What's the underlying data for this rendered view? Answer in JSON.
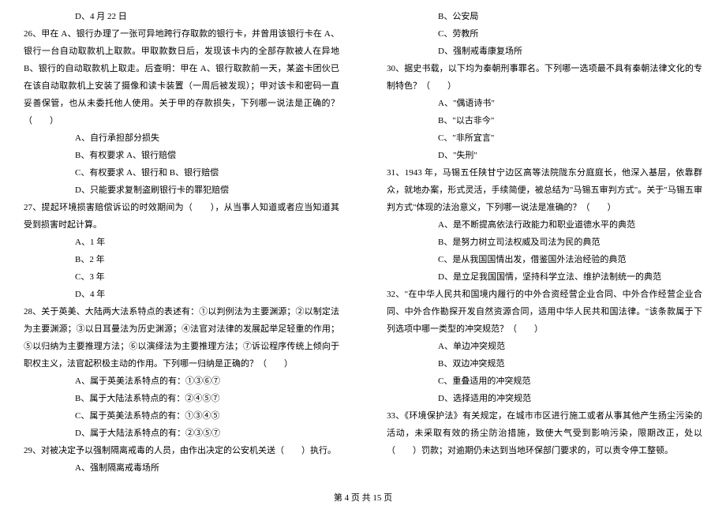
{
  "left_column": {
    "line1": "D、4 月 22 日",
    "q26_text": "26、甲在 A、银行办理了一张可异地跨行存取款的银行卡，并曾用该银行卡在 A、银行一台自动取款机上取款。甲取款数日后，发现该卡内的全部存款被人在异地 B、银行的自动取款机上取走。后查明：甲在 A、银行取款前一天，某盗卡团伙已在该自动取款机上安装了摄像和读卡装置（一周后被发现）；甲对该卡和密码一直妥善保管，也从未委托他人使用。关于甲的存款损失，下列哪一说法是正确的？（　　）",
    "q26_a": "A、自行承担部分损失",
    "q26_b": "B、有权要求 A、银行赔偿",
    "q26_c": "C、有权要求 A、银行和 B、银行赔偿",
    "q26_d": "D、只能要求复制盗刷银行卡的罪犯赔偿",
    "q27_text": "27、提起环境损害赔偿诉讼的时效期间为（　　），从当事人知道或者应当知道其受到损害时起计算。",
    "q27_a": "A、1 年",
    "q27_b": "B、2 年",
    "q27_c": "C、3 年",
    "q27_d": "D、4 年",
    "q28_text": "28、关于英美、大陆两大法系特点的表述有：①以判例法为主要渊源；②以制定法为主要渊源；③以日耳曼法为历史渊源；④法官对法律的发展起举足轻重的作用；⑤以归纳为主要推理方法；⑥以演绎法为主要推理方法；⑦诉讼程序传统上倾向于职权主义，法官起积极主动的作用。下列哪一归纳是正确的？（　　）",
    "q28_a": "A、属于英美法系特点的有：①③⑥⑦",
    "q28_b": "B、属于大陆法系特点的有：②④⑤⑦",
    "q28_c": "C、属于英美法系特点的有：①③④⑤",
    "q28_d": "D、属于大陆法系特点的有：②③⑤⑦",
    "q29_text": "29、对被决定予以强制隔离戒毒的人员，由作出决定的公安机关送（　　）执行。",
    "q29_a": "A、强制隔离戒毒场所"
  },
  "right_column": {
    "q29_b": "B、公安局",
    "q29_c": "C、劳教所",
    "q29_d": "D、强制戒毒康复场所",
    "q30_text": "30、据史书载，以下均为秦朝刑事罪名。下列哪一选项最不具有秦朝法律文化的专制特色？（　　）",
    "q30_a": "A、\"偶语诗书\"",
    "q30_b": "B、\"以古非今\"",
    "q30_c": "C、\"非所宜言\"",
    "q30_d": "D、\"失刑\"",
    "q31_text": "31、1943 年，马锡五任陕甘宁边区高等法院陇东分庭庭长，他深入基层，依靠群众，就地办案，形式灵活，手续简便，被总结为\"马锡五审判方式\"。关于\"马锡五审判方式\"体现的法治意义，下列哪一说法是准确的？（　　）",
    "q31_a": "A、是不断提高依法行政能力和职业道德水平的典范",
    "q31_b": "B、是努力树立司法权威及司法为民的典范",
    "q31_c": "C、是从我国国情出发，借鉴国外法治经验的典范",
    "q31_d": "D、是立足我国国情，坚持科学立法、维护法制统一的典范",
    "q32_text": "32、\"在中华人民共和国境内履行的中外合资经营企业合同、中外合作经营企业合同、中外合作勘探开发自然资源合同，适用中华人民共和国法律。\"该条款属于下列选项中哪一类型的冲突规范？（　　）",
    "q32_a": "A、单边冲突规范",
    "q32_b": "B、双边冲突规范",
    "q32_c": "C、重叠适用的冲突规范",
    "q32_d": "D、选择适用的冲突规范",
    "q33_text": "33、《环境保护法》有关规定，在城市市区进行施工或者从事其他产生扬尘污染的活动，未采取有效的扬尘防治措施，致使大气受到影响污染，限期改正，处以（　　）罚款；对逾期仍未达到当地环保部门要求的，可以责令停工整顿。"
  },
  "footer": "第 4 页 共 15 页"
}
